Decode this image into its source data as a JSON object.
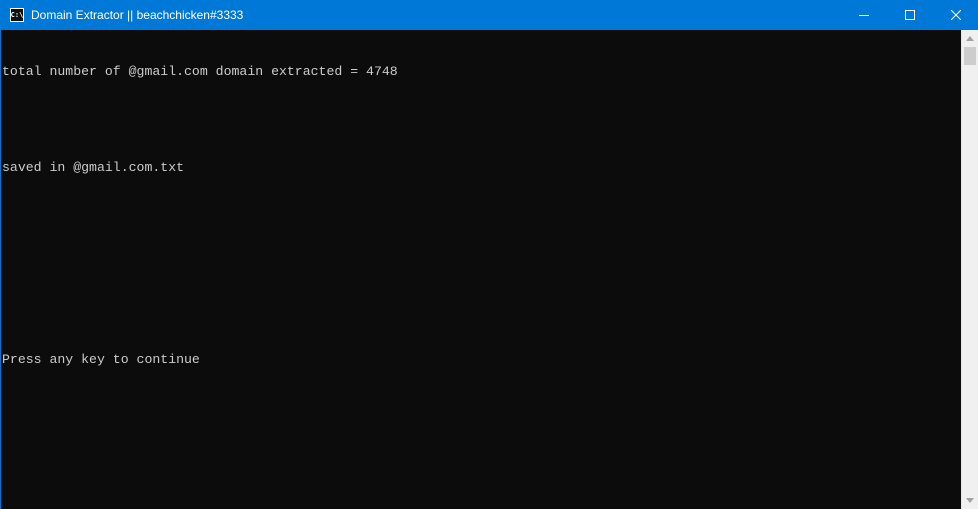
{
  "window": {
    "title": "Domain Extractor || beachchicken#3333",
    "icon_name": "console-app-icon",
    "icon_glyph": "C:\\",
    "accent_color": "#0078d7"
  },
  "controls": {
    "minimize_icon": "minimize-icon",
    "maximize_icon": "maximize-icon",
    "close_icon": "close-icon"
  },
  "console": {
    "background": "#0c0c0c",
    "text_color": "#cccccc",
    "lines": [
      "total number of @gmail.com domain extracted = 4748",
      "",
      "saved in @gmail.com.txt",
      "",
      "",
      "",
      "Press any key to continue"
    ]
  },
  "scrollbar": {
    "up_icon": "scroll-up-arrow-icon",
    "down_icon": "scroll-down-arrow-icon"
  }
}
